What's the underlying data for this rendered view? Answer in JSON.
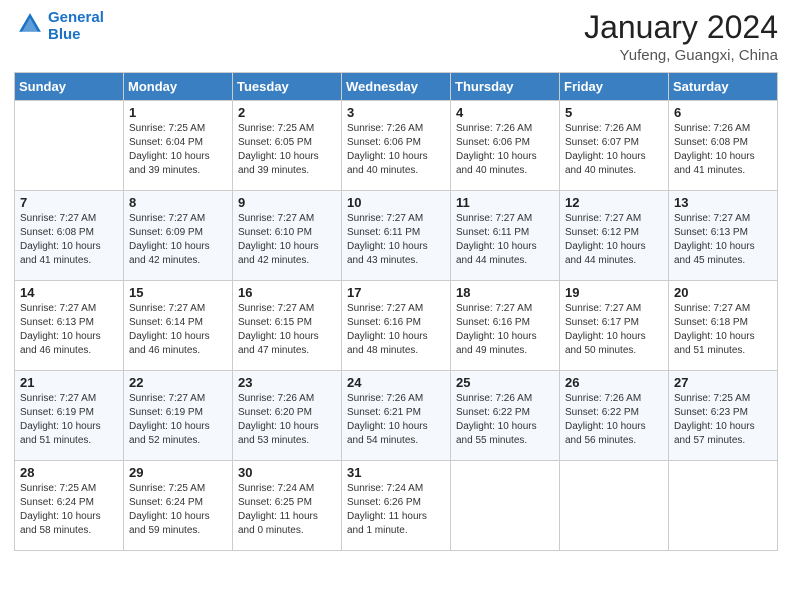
{
  "logo": {
    "line1": "General",
    "line2": "Blue"
  },
  "title": "January 2024",
  "subtitle": "Yufeng, Guangxi, China",
  "days_of_week": [
    "Sunday",
    "Monday",
    "Tuesday",
    "Wednesday",
    "Thursday",
    "Friday",
    "Saturday"
  ],
  "weeks": [
    [
      {
        "day": "",
        "info": ""
      },
      {
        "day": "1",
        "info": "Sunrise: 7:25 AM\nSunset: 6:04 PM\nDaylight: 10 hours and 39 minutes."
      },
      {
        "day": "2",
        "info": "Sunrise: 7:25 AM\nSunset: 6:05 PM\nDaylight: 10 hours and 39 minutes."
      },
      {
        "day": "3",
        "info": "Sunrise: 7:26 AM\nSunset: 6:06 PM\nDaylight: 10 hours and 40 minutes."
      },
      {
        "day": "4",
        "info": "Sunrise: 7:26 AM\nSunset: 6:06 PM\nDaylight: 10 hours and 40 minutes."
      },
      {
        "day": "5",
        "info": "Sunrise: 7:26 AM\nSunset: 6:07 PM\nDaylight: 10 hours and 40 minutes."
      },
      {
        "day": "6",
        "info": "Sunrise: 7:26 AM\nSunset: 6:08 PM\nDaylight: 10 hours and 41 minutes."
      }
    ],
    [
      {
        "day": "7",
        "info": "Sunrise: 7:27 AM\nSunset: 6:08 PM\nDaylight: 10 hours and 41 minutes."
      },
      {
        "day": "8",
        "info": "Sunrise: 7:27 AM\nSunset: 6:09 PM\nDaylight: 10 hours and 42 minutes."
      },
      {
        "day": "9",
        "info": "Sunrise: 7:27 AM\nSunset: 6:10 PM\nDaylight: 10 hours and 42 minutes."
      },
      {
        "day": "10",
        "info": "Sunrise: 7:27 AM\nSunset: 6:11 PM\nDaylight: 10 hours and 43 minutes."
      },
      {
        "day": "11",
        "info": "Sunrise: 7:27 AM\nSunset: 6:11 PM\nDaylight: 10 hours and 44 minutes."
      },
      {
        "day": "12",
        "info": "Sunrise: 7:27 AM\nSunset: 6:12 PM\nDaylight: 10 hours and 44 minutes."
      },
      {
        "day": "13",
        "info": "Sunrise: 7:27 AM\nSunset: 6:13 PM\nDaylight: 10 hours and 45 minutes."
      }
    ],
    [
      {
        "day": "14",
        "info": "Sunrise: 7:27 AM\nSunset: 6:13 PM\nDaylight: 10 hours and 46 minutes."
      },
      {
        "day": "15",
        "info": "Sunrise: 7:27 AM\nSunset: 6:14 PM\nDaylight: 10 hours and 46 minutes."
      },
      {
        "day": "16",
        "info": "Sunrise: 7:27 AM\nSunset: 6:15 PM\nDaylight: 10 hours and 47 minutes."
      },
      {
        "day": "17",
        "info": "Sunrise: 7:27 AM\nSunset: 6:16 PM\nDaylight: 10 hours and 48 minutes."
      },
      {
        "day": "18",
        "info": "Sunrise: 7:27 AM\nSunset: 6:16 PM\nDaylight: 10 hours and 49 minutes."
      },
      {
        "day": "19",
        "info": "Sunrise: 7:27 AM\nSunset: 6:17 PM\nDaylight: 10 hours and 50 minutes."
      },
      {
        "day": "20",
        "info": "Sunrise: 7:27 AM\nSunset: 6:18 PM\nDaylight: 10 hours and 51 minutes."
      }
    ],
    [
      {
        "day": "21",
        "info": "Sunrise: 7:27 AM\nSunset: 6:19 PM\nDaylight: 10 hours and 51 minutes."
      },
      {
        "day": "22",
        "info": "Sunrise: 7:27 AM\nSunset: 6:19 PM\nDaylight: 10 hours and 52 minutes."
      },
      {
        "day": "23",
        "info": "Sunrise: 7:26 AM\nSunset: 6:20 PM\nDaylight: 10 hours and 53 minutes."
      },
      {
        "day": "24",
        "info": "Sunrise: 7:26 AM\nSunset: 6:21 PM\nDaylight: 10 hours and 54 minutes."
      },
      {
        "day": "25",
        "info": "Sunrise: 7:26 AM\nSunset: 6:22 PM\nDaylight: 10 hours and 55 minutes."
      },
      {
        "day": "26",
        "info": "Sunrise: 7:26 AM\nSunset: 6:22 PM\nDaylight: 10 hours and 56 minutes."
      },
      {
        "day": "27",
        "info": "Sunrise: 7:25 AM\nSunset: 6:23 PM\nDaylight: 10 hours and 57 minutes."
      }
    ],
    [
      {
        "day": "28",
        "info": "Sunrise: 7:25 AM\nSunset: 6:24 PM\nDaylight: 10 hours and 58 minutes."
      },
      {
        "day": "29",
        "info": "Sunrise: 7:25 AM\nSunset: 6:24 PM\nDaylight: 10 hours and 59 minutes."
      },
      {
        "day": "30",
        "info": "Sunrise: 7:24 AM\nSunset: 6:25 PM\nDaylight: 11 hours and 0 minutes."
      },
      {
        "day": "31",
        "info": "Sunrise: 7:24 AM\nSunset: 6:26 PM\nDaylight: 11 hours and 1 minute."
      },
      {
        "day": "",
        "info": ""
      },
      {
        "day": "",
        "info": ""
      },
      {
        "day": "",
        "info": ""
      }
    ]
  ]
}
